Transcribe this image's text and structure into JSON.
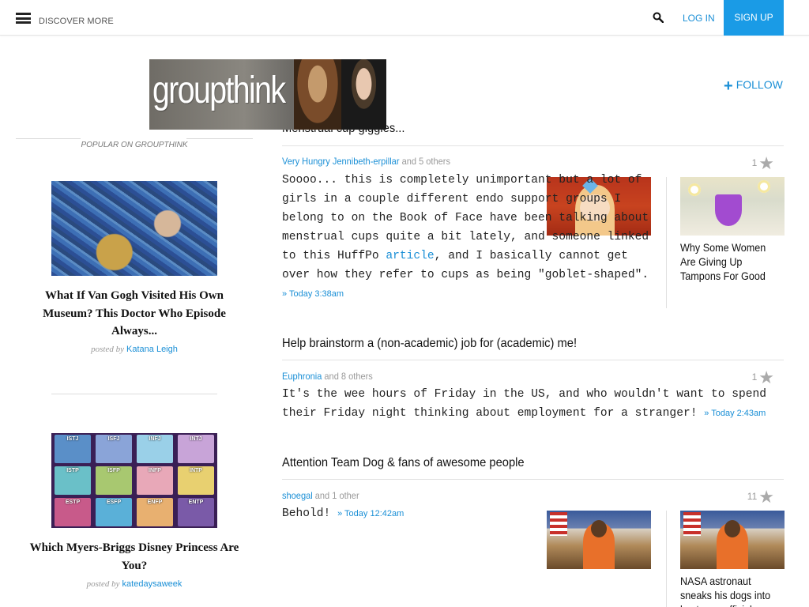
{
  "topbar": {
    "discover_label": "DISCOVER MORE",
    "login_label": "LOG IN",
    "signup_label": "SIGN UP",
    "icons": {
      "menu": "hamburger-menu-icon",
      "search": "search-icon"
    }
  },
  "banner": {
    "text": "groupthink"
  },
  "follow_label": "FOLLOW",
  "sidebar": {
    "section_label": "POPULAR ON GROUPTHINK",
    "cards": [
      {
        "title": "What If Van Gogh Visited His Own Museum? This Doctor Who Episode Always...",
        "posted_by": "posted by",
        "author": "Katana Leigh"
      },
      {
        "title": "Which Myers-Briggs Disney Princess Are You?",
        "posted_by": "posted by",
        "author": "katedaysaweek",
        "mbti": [
          "ISTJ",
          "ISFJ",
          "INFJ",
          "INTJ",
          "ISTP",
          "ISFP",
          "INFP",
          "INTP",
          "ESTP",
          "ESFP",
          "ENFP",
          "ENTP"
        ]
      }
    ]
  },
  "posts": [
    {
      "title": "Menstrual cup giggles...",
      "user": "Very Hungry Jennibeth-erpillar",
      "others": "and 5 others",
      "score": "1",
      "body_pre": "Soooo... this is completely unimportant but a lot of girls in a couple different endo support groups I belong to on the Book of Face have been talking about menstrual cups quite a bit lately, and someone linked to this HuffPo ",
      "link": "article",
      "body_post": ", and I basically cannot get over how they refer to cups as being \"goblet-shaped\".",
      "timestamp": "» Today 3:38am",
      "related_title": "Why Some Women Are Giving Up Tampons For Good"
    },
    {
      "title": "Help brainstorm a (non-academic) job for (academic) me!",
      "user": "Euphronia",
      "others": "and 8 others",
      "score": "1",
      "body": "It's the wee hours of Friday in the US, and who wouldn't want to spend their Friday night thinking about employment for a stranger!",
      "timestamp": "» Today 2:43am"
    },
    {
      "title": "Attention Team Dog & fans of awesome people",
      "user": "shoegal",
      "others": "and 1 other",
      "score": "11",
      "body": "Behold!",
      "timestamp": "» Today 12:42am",
      "related_title": "NASA astronaut sneaks his dogs into best ever official portrait"
    }
  ],
  "icons": {
    "star": "star-icon",
    "plus": "plus-icon"
  }
}
